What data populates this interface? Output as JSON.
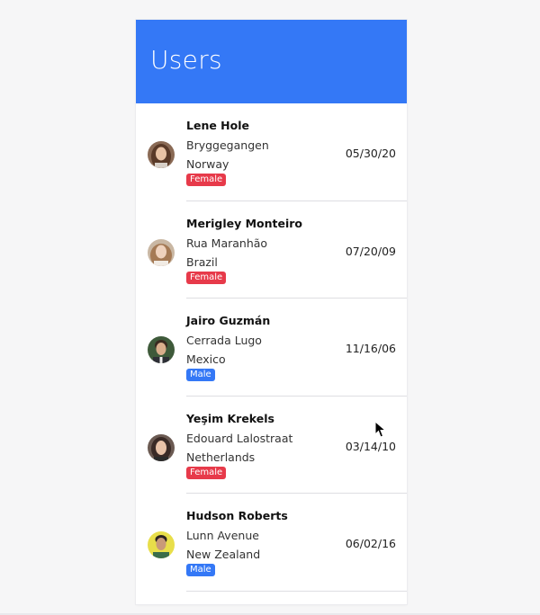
{
  "header": {
    "title": "Users"
  },
  "users": [
    {
      "name": "Lene Hole",
      "street": "Bryggegangen",
      "country": "Norway",
      "gender": "Female",
      "date": "05/30/20"
    },
    {
      "name": "Merigley Monteiro",
      "street": "Rua Maranhão",
      "country": "Brazil",
      "gender": "Female",
      "date": "07/20/09"
    },
    {
      "name": "Jairo Guzmán",
      "street": "Cerrada Lugo",
      "country": "Mexico",
      "gender": "Male",
      "date": "11/16/06"
    },
    {
      "name": "Yeşim Krekels",
      "street": "Edouard Lalostraat",
      "country": "Netherlands",
      "gender": "Female",
      "date": "03/14/10"
    },
    {
      "name": "Hudson Roberts",
      "street": "Lunn Avenue",
      "country": "New Zealand",
      "gender": "Male",
      "date": "06/02/16"
    }
  ],
  "colors": {
    "header": "#3478f6",
    "female_badge": "#e73a4a",
    "male_badge": "#3478f6"
  }
}
